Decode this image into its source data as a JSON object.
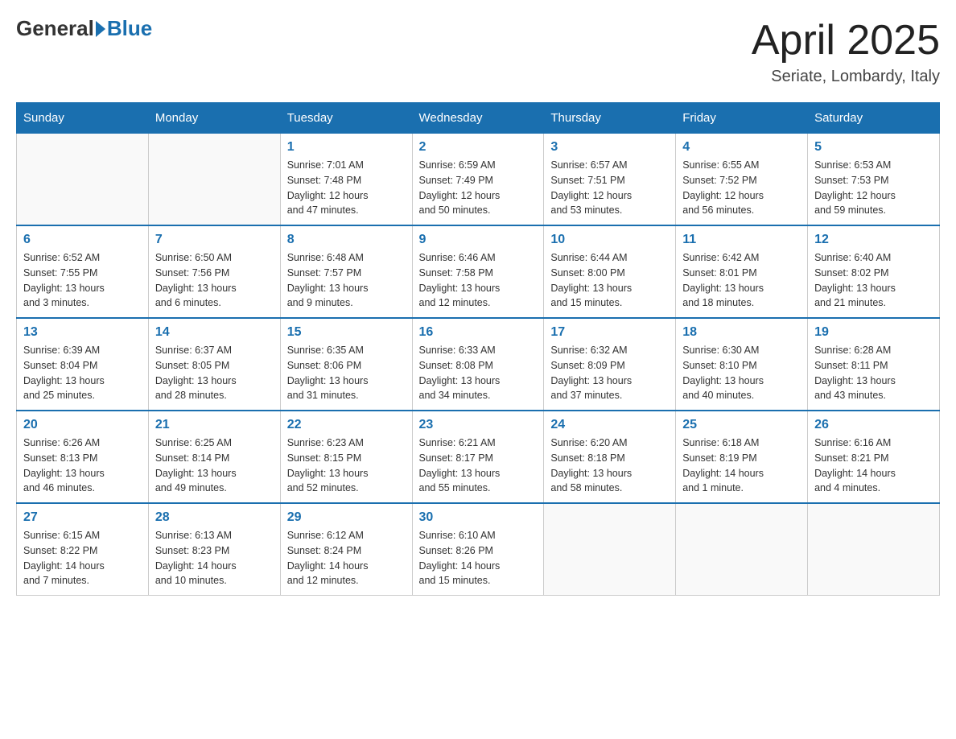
{
  "logo": {
    "general": "General",
    "blue": "Blue"
  },
  "header": {
    "title": "April 2025",
    "location": "Seriate, Lombardy, Italy"
  },
  "weekdays": [
    "Sunday",
    "Monday",
    "Tuesday",
    "Wednesday",
    "Thursday",
    "Friday",
    "Saturday"
  ],
  "weeks": [
    [
      {
        "day": "",
        "info": ""
      },
      {
        "day": "",
        "info": ""
      },
      {
        "day": "1",
        "info": "Sunrise: 7:01 AM\nSunset: 7:48 PM\nDaylight: 12 hours\nand 47 minutes."
      },
      {
        "day": "2",
        "info": "Sunrise: 6:59 AM\nSunset: 7:49 PM\nDaylight: 12 hours\nand 50 minutes."
      },
      {
        "day": "3",
        "info": "Sunrise: 6:57 AM\nSunset: 7:51 PM\nDaylight: 12 hours\nand 53 minutes."
      },
      {
        "day": "4",
        "info": "Sunrise: 6:55 AM\nSunset: 7:52 PM\nDaylight: 12 hours\nand 56 minutes."
      },
      {
        "day": "5",
        "info": "Sunrise: 6:53 AM\nSunset: 7:53 PM\nDaylight: 12 hours\nand 59 minutes."
      }
    ],
    [
      {
        "day": "6",
        "info": "Sunrise: 6:52 AM\nSunset: 7:55 PM\nDaylight: 13 hours\nand 3 minutes."
      },
      {
        "day": "7",
        "info": "Sunrise: 6:50 AM\nSunset: 7:56 PM\nDaylight: 13 hours\nand 6 minutes."
      },
      {
        "day": "8",
        "info": "Sunrise: 6:48 AM\nSunset: 7:57 PM\nDaylight: 13 hours\nand 9 minutes."
      },
      {
        "day": "9",
        "info": "Sunrise: 6:46 AM\nSunset: 7:58 PM\nDaylight: 13 hours\nand 12 minutes."
      },
      {
        "day": "10",
        "info": "Sunrise: 6:44 AM\nSunset: 8:00 PM\nDaylight: 13 hours\nand 15 minutes."
      },
      {
        "day": "11",
        "info": "Sunrise: 6:42 AM\nSunset: 8:01 PM\nDaylight: 13 hours\nand 18 minutes."
      },
      {
        "day": "12",
        "info": "Sunrise: 6:40 AM\nSunset: 8:02 PM\nDaylight: 13 hours\nand 21 minutes."
      }
    ],
    [
      {
        "day": "13",
        "info": "Sunrise: 6:39 AM\nSunset: 8:04 PM\nDaylight: 13 hours\nand 25 minutes."
      },
      {
        "day": "14",
        "info": "Sunrise: 6:37 AM\nSunset: 8:05 PM\nDaylight: 13 hours\nand 28 minutes."
      },
      {
        "day": "15",
        "info": "Sunrise: 6:35 AM\nSunset: 8:06 PM\nDaylight: 13 hours\nand 31 minutes."
      },
      {
        "day": "16",
        "info": "Sunrise: 6:33 AM\nSunset: 8:08 PM\nDaylight: 13 hours\nand 34 minutes."
      },
      {
        "day": "17",
        "info": "Sunrise: 6:32 AM\nSunset: 8:09 PM\nDaylight: 13 hours\nand 37 minutes."
      },
      {
        "day": "18",
        "info": "Sunrise: 6:30 AM\nSunset: 8:10 PM\nDaylight: 13 hours\nand 40 minutes."
      },
      {
        "day": "19",
        "info": "Sunrise: 6:28 AM\nSunset: 8:11 PM\nDaylight: 13 hours\nand 43 minutes."
      }
    ],
    [
      {
        "day": "20",
        "info": "Sunrise: 6:26 AM\nSunset: 8:13 PM\nDaylight: 13 hours\nand 46 minutes."
      },
      {
        "day": "21",
        "info": "Sunrise: 6:25 AM\nSunset: 8:14 PM\nDaylight: 13 hours\nand 49 minutes."
      },
      {
        "day": "22",
        "info": "Sunrise: 6:23 AM\nSunset: 8:15 PM\nDaylight: 13 hours\nand 52 minutes."
      },
      {
        "day": "23",
        "info": "Sunrise: 6:21 AM\nSunset: 8:17 PM\nDaylight: 13 hours\nand 55 minutes."
      },
      {
        "day": "24",
        "info": "Sunrise: 6:20 AM\nSunset: 8:18 PM\nDaylight: 13 hours\nand 58 minutes."
      },
      {
        "day": "25",
        "info": "Sunrise: 6:18 AM\nSunset: 8:19 PM\nDaylight: 14 hours\nand 1 minute."
      },
      {
        "day": "26",
        "info": "Sunrise: 6:16 AM\nSunset: 8:21 PM\nDaylight: 14 hours\nand 4 minutes."
      }
    ],
    [
      {
        "day": "27",
        "info": "Sunrise: 6:15 AM\nSunset: 8:22 PM\nDaylight: 14 hours\nand 7 minutes."
      },
      {
        "day": "28",
        "info": "Sunrise: 6:13 AM\nSunset: 8:23 PM\nDaylight: 14 hours\nand 10 minutes."
      },
      {
        "day": "29",
        "info": "Sunrise: 6:12 AM\nSunset: 8:24 PM\nDaylight: 14 hours\nand 12 minutes."
      },
      {
        "day": "30",
        "info": "Sunrise: 6:10 AM\nSunset: 8:26 PM\nDaylight: 14 hours\nand 15 minutes."
      },
      {
        "day": "",
        "info": ""
      },
      {
        "day": "",
        "info": ""
      },
      {
        "day": "",
        "info": ""
      }
    ]
  ]
}
